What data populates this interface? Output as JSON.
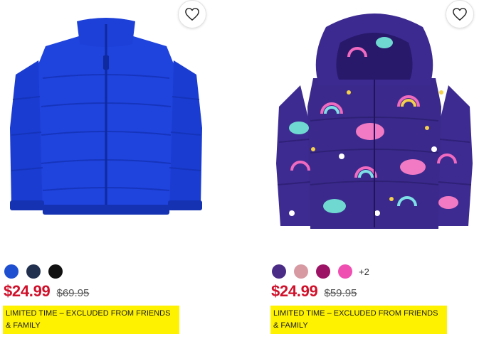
{
  "products": [
    {
      "wishlist": "heart-icon",
      "swatches": [
        "#1f4fd1",
        "#22304f",
        "#111111"
      ],
      "swatch_more": "",
      "price": "$24.99",
      "original_price": "$69.95",
      "promo": "LIMITED TIME – EXCLUDED FROM FRIENDS & FAMILY"
    },
    {
      "wishlist": "heart-icon",
      "swatches": [
        "#4a2c86",
        "#d79aa3",
        "#9c1365",
        "#ee4fb0"
      ],
      "swatch_more": "+2",
      "price": "$24.99",
      "original_price": "$59.95",
      "promo": "LIMITED TIME – EXCLUDED FROM FRIENDS & FAMILY"
    }
  ],
  "colors": {
    "price_red": "#d0112b",
    "promo_yellow": "#fff200",
    "jacket_blue": "#1b3fd6",
    "jacket_purple": "#3b2a8c"
  }
}
